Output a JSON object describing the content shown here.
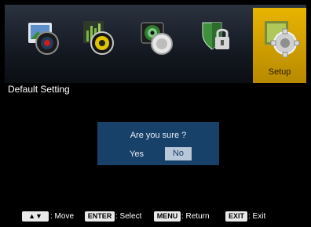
{
  "tabs": [
    {
      "name": "picture",
      "icon": "picture-icon"
    },
    {
      "name": "sound",
      "icon": "sound-icon"
    },
    {
      "name": "channel",
      "icon": "channel-icon"
    },
    {
      "name": "lock",
      "icon": "lock-icon"
    },
    {
      "name": "setup",
      "icon": "setup-gear-icon",
      "label": "Setup",
      "active": true
    }
  ],
  "menu": {
    "title": "Default Setting"
  },
  "dialog": {
    "question": "Are you sure ?",
    "yes": "Yes",
    "no": "No",
    "selected": "No"
  },
  "footer": {
    "move_key": "▲▼",
    "move_label": ": Move",
    "enter_key": "ENTER",
    "enter_label": ": Select",
    "menu_key": "MENU",
    "menu_label": ": Return",
    "exit_key": "EXIT",
    "exit_label": ": Exit"
  },
  "colors": {
    "accent": "#e8b400",
    "dialog_bg": "#18416a",
    "selected_bg": "#b9c8d8"
  }
}
